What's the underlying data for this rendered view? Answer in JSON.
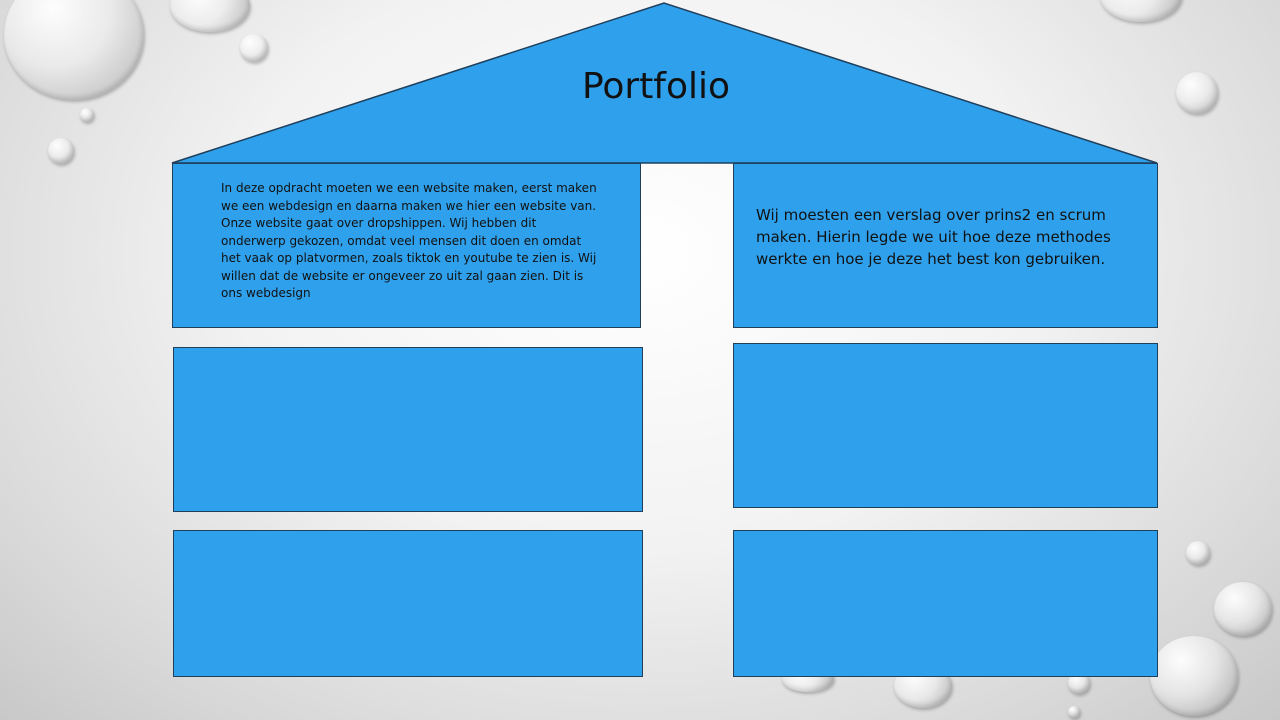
{
  "slide": {
    "title": "Portfolio",
    "boxes": {
      "top_left": "In  deze opdracht moeten we een website maken, eerst maken we een webdesign en daarna maken we hier een website van. Onze website gaat over dropshippen. Wij hebben dit onderwerp gekozen, omdat veel mensen dit doen en omdat het vaak op platvormen, zoals tiktok en youtube te zien is.  Wij willen dat de website er ongeveer zo uit zal gaan zien. Dit is ons webdesign",
      "top_right": "Wij moesten een verslag over prins2 en scrum maken. Hierin legde we uit hoe deze methodes werkte en hoe je deze het best kon gebruiken.",
      "middle_left": "",
      "middle_right": "",
      "bottom_left": "",
      "bottom_right": ""
    }
  },
  "colors": {
    "box_fill": "#2fa0ec",
    "box_border": "#1f3f5b"
  }
}
